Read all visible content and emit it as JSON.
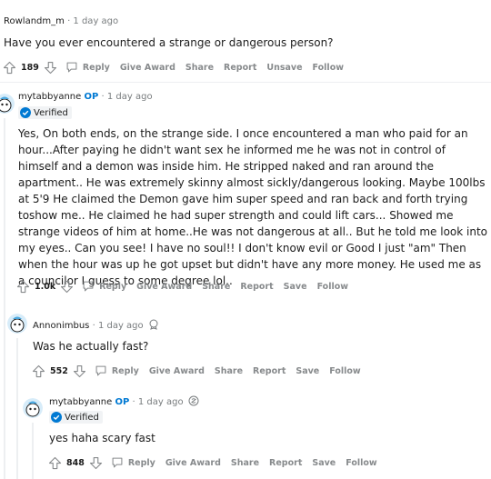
{
  "post": {
    "username": "Rowlandm_m",
    "time": "1 day ago",
    "title": "Have you ever encountered a strange or dangerous person?",
    "votes": "189",
    "actions": [
      "Reply",
      "Give Award",
      "Share",
      "Report",
      "Unsave",
      "Follow"
    ]
  },
  "comments": [
    {
      "username": "mytabbyanne",
      "op": "OP",
      "time": "1 day ago",
      "verified": "Verified",
      "text": "Yes, On both ends, on the strange side. I once encountered a man who paid for an hour...After paying he didn't want sex he informed me he was not in control of himself and a demon was inside him. He stripped naked and ran around the apartment.. He was extremely skinny almost sickly/dangerous looking. Maybe 100lbs at 5'9 He claimed the Demon gave him super speed and ran back and forth trying toshow me.. He claimed he had super strength and could lift cars... Showed me strange videos of him at home..He was not dangerous at all.. But he told me look into my eyes.. Can you see! I have no soul!! I don't know evil or Good I just \"am\" Then when the hour was up he got upset but didn't have any more money. He used me as a councilor I guess to some degree lol..",
      "votes": "1.0k",
      "actions": [
        "Reply",
        "Give Award",
        "Share",
        "Report",
        "Save",
        "Follow"
      ]
    },
    {
      "username": "Annonimbus",
      "time": "1 day ago",
      "text": "Was he actually fast?",
      "votes": "552",
      "actions": [
        "Reply",
        "Give Award",
        "Share",
        "Report",
        "Save",
        "Follow"
      ]
    },
    {
      "username": "mytabbyanne",
      "op": "OP",
      "time": "1 day ago",
      "verified": "Verified",
      "text": "yes haha scary fast",
      "votes": "848",
      "actions": [
        "Reply",
        "Give Award",
        "Share",
        "Report",
        "Save",
        "Follow"
      ]
    }
  ],
  "colors": {
    "op": "#0079d3",
    "meta": "#787c7e",
    "action": "#878a8c",
    "thread_line": "#edeff1",
    "avatar": "#4aa8e0"
  },
  "icons": [
    "upvote-icon",
    "downvote-icon",
    "reply-icon",
    "verified-check-icon",
    "avatar-icon",
    "award-icon"
  ]
}
